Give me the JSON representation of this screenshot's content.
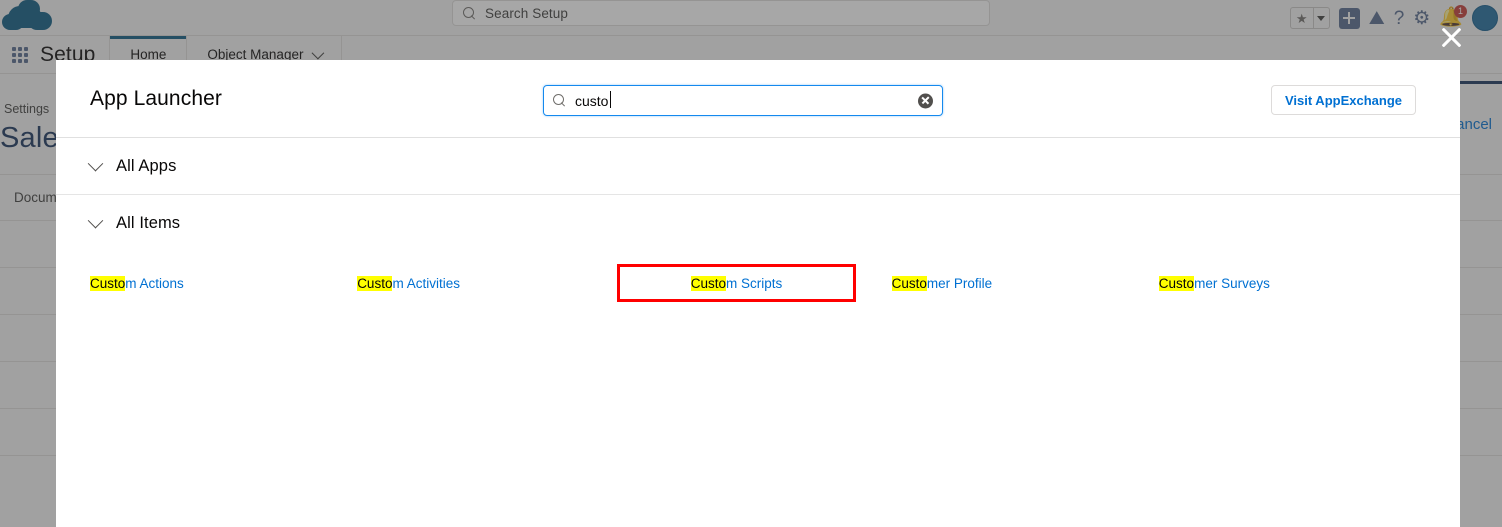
{
  "global_header": {
    "logo_icon": "salesforce-cloud-logo",
    "search": {
      "placeholder": "Search Setup",
      "icon": "search-icon"
    },
    "icons": [
      {
        "name": "favorites-star-icon",
        "glyph": "★"
      },
      {
        "name": "favorites-dropdown-icon",
        "glyph": "▾"
      },
      {
        "name": "add-icon",
        "glyph": "+"
      },
      {
        "name": "trailhead-icon",
        "glyph": "⛰"
      },
      {
        "name": "help-icon",
        "glyph": "?"
      },
      {
        "name": "setup-gear-icon",
        "glyph": "⚙"
      },
      {
        "name": "notifications-bell-icon",
        "glyph": "🔔"
      },
      {
        "name": "user-avatar",
        "glyph": ""
      }
    ],
    "notification_count": "1"
  },
  "setup_nav": {
    "app_launcher_icon": "app-launcher-waffle-icon",
    "app_name": "Setup",
    "tabs": [
      {
        "label": "Home",
        "active": true,
        "has_dropdown": false
      },
      {
        "label": "Object Manager",
        "active": false,
        "has_dropdown": true
      }
    ]
  },
  "background_page": {
    "breadcrumb": "Settings",
    "title": "Sales",
    "cancel_label": "Cancel",
    "table_cell": "Docum"
  },
  "modal": {
    "title": "App Launcher",
    "close_icon": "close-icon",
    "search": {
      "value": "custo",
      "icon": "search-icon",
      "clear_icon": "clear-input-icon"
    },
    "appexchange_button": "Visit AppExchange",
    "sections": [
      {
        "label": "All Apps",
        "icon": "chevron-down-icon",
        "expanded": true
      },
      {
        "label": "All Items",
        "icon": "chevron-down-icon",
        "expanded": true
      }
    ],
    "items": [
      {
        "highlight": "Custo",
        "rest": "m Actions",
        "boxed": false
      },
      {
        "highlight": "Custo",
        "rest": "m Activities",
        "boxed": false
      },
      {
        "highlight": "Custo",
        "rest": "m Scripts",
        "boxed": true
      },
      {
        "highlight": "Custo",
        "rest": "mer Profile",
        "boxed": false
      },
      {
        "highlight": "Custo",
        "rest": "mer Surveys",
        "boxed": false
      }
    ]
  },
  "colors": {
    "brand_blue": "#0070d2",
    "link_blue": "#0070d2",
    "highlight_yellow": "#ffff00",
    "annotation_red": "#ff0000",
    "header_bg": "#f3f3f3",
    "active_tab_underline": "#0b5a80",
    "notification_red": "#c23934"
  }
}
